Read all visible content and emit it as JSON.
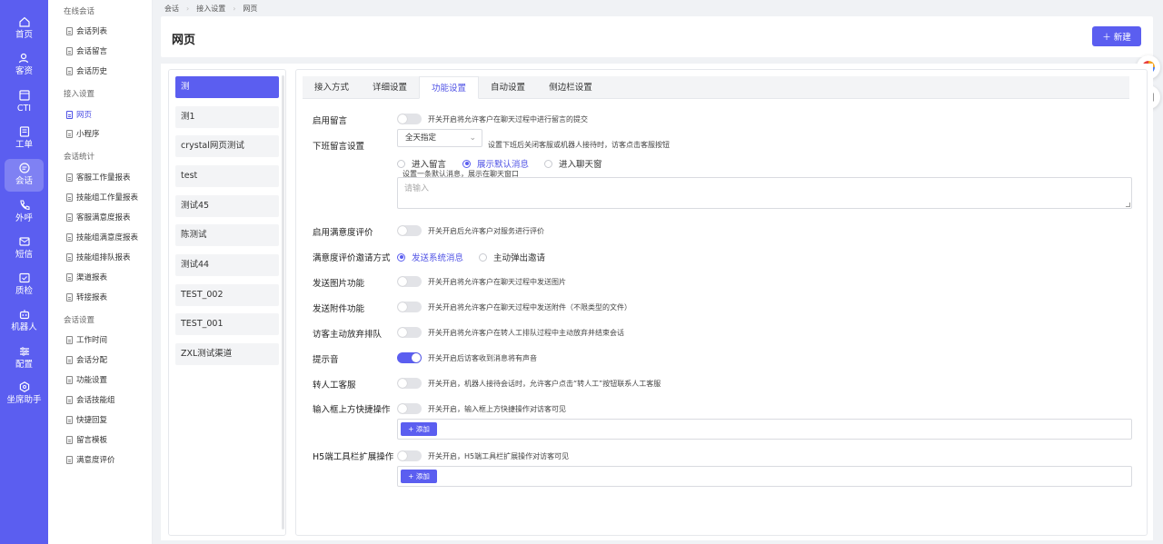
{
  "nav": [
    {
      "label": "首页",
      "icon": "home-icon"
    },
    {
      "label": "客资",
      "icon": "users-icon"
    },
    {
      "label": "CTI",
      "icon": "cti-icon"
    },
    {
      "label": "工单",
      "icon": "ticket-icon"
    },
    {
      "label": "会话",
      "icon": "chat-icon"
    },
    {
      "label": "外呼",
      "icon": "phone-icon"
    },
    {
      "label": "短信",
      "icon": "sms-icon"
    },
    {
      "label": "质检",
      "icon": "inspect-icon"
    },
    {
      "label": "机器人",
      "icon": "robot-icon"
    },
    {
      "label": "配置",
      "icon": "config-icon"
    },
    {
      "label": "坐席助手",
      "icon": "assistant-icon"
    }
  ],
  "submenu": {
    "groups": [
      "在线会话",
      "接入设置",
      "会话统计",
      "会话设置"
    ],
    "online": [
      "会话列表",
      "会话留言",
      "会话历史"
    ],
    "access": [
      "网页",
      "小程序"
    ],
    "stats": [
      "客服工作量报表",
      "技能组工作量报表",
      "客服满意度报表",
      "技能组满意度报表",
      "技能组排队报表",
      "渠道报表",
      "转接报表"
    ],
    "settings": [
      "工作时间",
      "会话分配",
      "功能设置",
      "会话技能组",
      "快捷回复",
      "留言模板",
      "满意度评价"
    ]
  },
  "breadcrumb": [
    "会话",
    "接入设置",
    "网页"
  ],
  "page_title": "网页",
  "new_button": "新建",
  "channels": [
    "测",
    "测1",
    "crystal网页测试",
    "test",
    "测试45",
    "陈测试",
    "测试44",
    "TEST_002",
    "TEST_001",
    "ZXL测试渠道"
  ],
  "tabs": [
    "接入方式",
    "详细设置",
    "功能设置",
    "自动设置",
    "侧边栏设置"
  ],
  "settings": {
    "leave_msg": {
      "label": "启用留言",
      "hint": "开关开启将允许客户在聊天过程中进行留言的提交"
    },
    "offduty": {
      "label": "下班留言设置",
      "select": "全天指定",
      "hint": "设置下班后关闭客服或机器人接待时，访客点击客服按钮",
      "options": [
        "进入留言",
        "展示默认消息",
        "进入聊天窗"
      ],
      "sub_hint": "设置一条默认消息，展示在聊天窗口",
      "placeholder": "请输入"
    },
    "satisfaction": {
      "label": "启用满意度评价",
      "hint": "开关开启后允许客户对服务进行评价"
    },
    "invite": {
      "label": "满意度评价邀请方式",
      "options": [
        "发送系统消息",
        "主动弹出邀请"
      ]
    },
    "image": {
      "label": "发送图片功能",
      "hint": "开关开启将允许客户在聊天过程中发送图片"
    },
    "attach": {
      "label": "发送附件功能",
      "hint": "开关开启将允许客户在聊天过程中发送附件（不限类型的文件）"
    },
    "abandon": {
      "label": "访客主动放弃排队",
      "hint": "开关开启将允许客户在转人工排队过程中主动放弃并结束会话"
    },
    "sound": {
      "label": "提示音",
      "hint": "开关开启后访客收到消息将有声音"
    },
    "transfer": {
      "label": "转人工客服",
      "hint": "开关开启，机器人接待会话时，允许客户点击“转人工”按钮联系人工客服"
    },
    "quick": {
      "label": "输入框上方快捷操作",
      "hint": "开关开启，输入框上方快捷操作对访客可见",
      "add": "+ 添加"
    },
    "h5": {
      "label": "H5端工具栏扩展操作",
      "hint": "开关开启，H5端工具栏扩展操作对访客可见",
      "add": "+ 添加"
    }
  },
  "colors": {
    "accent": "#5b5ef0",
    "nav_bg": "#5b5ef0"
  }
}
